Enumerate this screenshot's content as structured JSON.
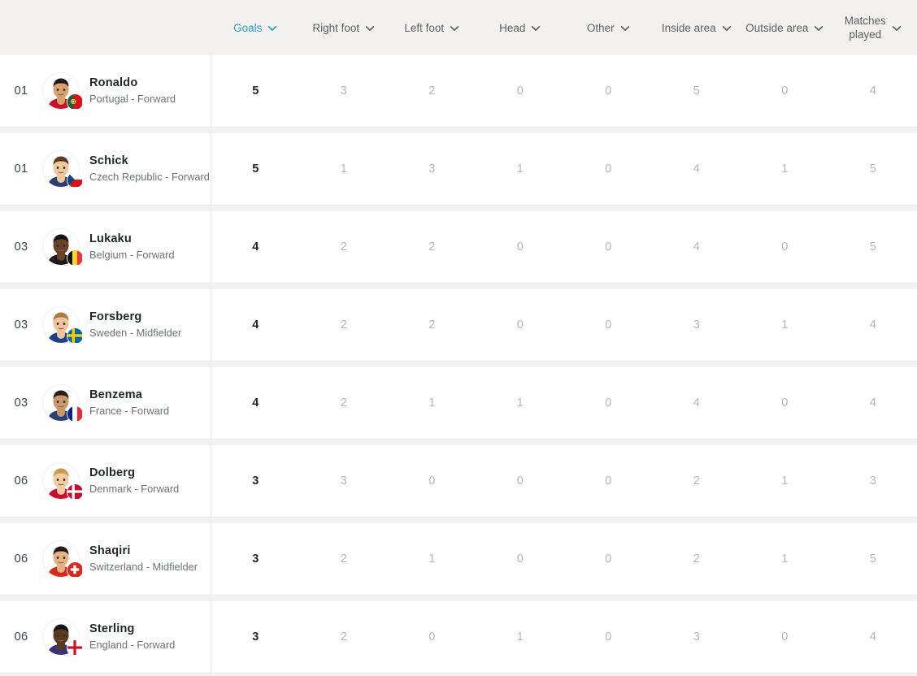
{
  "header": {
    "columns": [
      {
        "label": "Goals",
        "active": true,
        "icon": "chevron-down-icon",
        "key": "goals"
      },
      {
        "label": "Right foot",
        "active": false,
        "icon": "chevron-down-icon",
        "key": "right_foot"
      },
      {
        "label": "Left foot",
        "active": false,
        "icon": "chevron-down-icon",
        "key": "left_foot"
      },
      {
        "label": "Head",
        "active": false,
        "icon": "chevron-down-icon",
        "key": "head"
      },
      {
        "label": "Other",
        "active": false,
        "icon": "chevron-down-icon",
        "key": "other"
      },
      {
        "label": "Inside area",
        "active": false,
        "icon": "chevron-down-icon",
        "key": "inside_area"
      },
      {
        "label": "Outside area",
        "active": false,
        "icon": "chevron-down-icon",
        "key": "outside_area"
      },
      {
        "label": "Matches\nplayed",
        "active": false,
        "icon": "chevron-down-icon",
        "key": "matches_played"
      }
    ]
  },
  "colors": {
    "page_background": "#f2f1ef",
    "row_background": "#ffffff",
    "active_header": "#2b9fc4",
    "header_text": "#5d5f63",
    "primary_value": "#23262b",
    "muted_value": "#b3b4b6",
    "rank_text": "#3a4252"
  },
  "rows": [
    {
      "rank": "01",
      "name": "Ronaldo",
      "meta": "Portugal - Forward",
      "country": "Portugal",
      "position": "Forward",
      "flag": "flag-portugal",
      "values": [
        "5",
        "3",
        "2",
        "0",
        "0",
        "5",
        "0",
        "4"
      ]
    },
    {
      "rank": "01",
      "name": "Schick",
      "meta": "Czech Republic - Forward",
      "country": "Czech Republic",
      "position": "Forward",
      "flag": "flag-czech-republic",
      "values": [
        "5",
        "1",
        "3",
        "1",
        "0",
        "4",
        "1",
        "5"
      ]
    },
    {
      "rank": "03",
      "name": "Lukaku",
      "meta": "Belgium - Forward",
      "country": "Belgium",
      "position": "Forward",
      "flag": "flag-belgium",
      "values": [
        "4",
        "2",
        "2",
        "0",
        "0",
        "4",
        "0",
        "5"
      ]
    },
    {
      "rank": "03",
      "name": "Forsberg",
      "meta": "Sweden - Midfielder",
      "country": "Sweden",
      "position": "Midfielder",
      "flag": "flag-sweden",
      "values": [
        "4",
        "2",
        "2",
        "0",
        "0",
        "3",
        "1",
        "4"
      ]
    },
    {
      "rank": "03",
      "name": "Benzema",
      "meta": "France - Forward",
      "country": "France",
      "position": "Forward",
      "flag": "flag-france",
      "values": [
        "4",
        "2",
        "1",
        "1",
        "0",
        "4",
        "0",
        "4"
      ]
    },
    {
      "rank": "06",
      "name": "Dolberg",
      "meta": "Denmark - Forward",
      "country": "Denmark",
      "position": "Forward",
      "flag": "flag-denmark",
      "values": [
        "3",
        "3",
        "0",
        "0",
        "0",
        "2",
        "1",
        "3"
      ]
    },
    {
      "rank": "06",
      "name": "Shaqiri",
      "meta": "Switzerland - Midfielder",
      "country": "Switzerland",
      "position": "Midfielder",
      "flag": "flag-switzerland",
      "values": [
        "3",
        "2",
        "1",
        "0",
        "0",
        "2",
        "1",
        "5"
      ]
    },
    {
      "rank": "06",
      "name": "Sterling",
      "meta": "England - Forward",
      "country": "England",
      "position": "Forward",
      "flag": "flag-england",
      "values": [
        "3",
        "2",
        "0",
        "1",
        "0",
        "3",
        "0",
        "4"
      ]
    }
  ]
}
